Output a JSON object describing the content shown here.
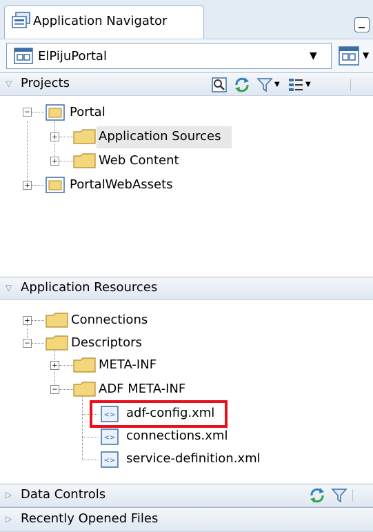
{
  "window": {
    "tab_title": "Application Navigator"
  },
  "app_selector": {
    "value": "ElPijuPortal"
  },
  "projects_panel": {
    "title": "Projects",
    "tree": [
      {
        "label": "Portal"
      },
      {
        "label": "Application Sources",
        "selected": true
      },
      {
        "label": "Web Content"
      },
      {
        "label": "PortalWebAssets"
      }
    ]
  },
  "resources_panel": {
    "title": "Application Resources",
    "tree": [
      {
        "label": "Connections"
      },
      {
        "label": "Descriptors"
      },
      {
        "label": "META-INF"
      },
      {
        "label": "ADF META-INF"
      },
      {
        "label": "adf-config.xml",
        "highlighted": true
      },
      {
        "label": "connections.xml"
      },
      {
        "label": "service-definition.xml"
      }
    ]
  },
  "bottom_panels": [
    {
      "title": "Data Controls"
    },
    {
      "title": "Recently Opened Files"
    }
  ],
  "colors": {
    "highlight_box": "#e8101a",
    "folder": "#f3d77a",
    "header_bg": "#dfe7f1"
  }
}
